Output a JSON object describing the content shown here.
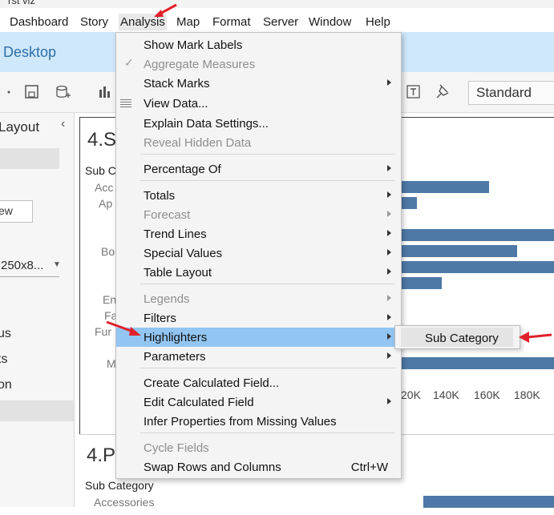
{
  "window": {
    "title_fragment": "rst viz"
  },
  "menubar": {
    "items": [
      "Dashboard",
      "Story",
      "Analysis",
      "Map",
      "Format",
      "Server",
      "Window",
      "Help"
    ]
  },
  "app_band": {
    "title": "Desktop"
  },
  "toolbar": {
    "mark_type": "Standard"
  },
  "left_pane": {
    "header": "Layout",
    "button": "ew",
    "size_value": "250x8...",
    "items": [
      "us",
      "ts",
      "on"
    ]
  },
  "view1": {
    "title": "4.S",
    "sub_header": "Sub C",
    "row_labels": [
      "Acc",
      "Ap",
      "Bo",
      "En",
      "Fa",
      "Fur",
      "M"
    ],
    "bars": [
      {
        "start": 0,
        "end": 0.574
      },
      {
        "start": 0,
        "end": 0.105
      },
      {
        "start": 0,
        "end": 1.0
      },
      {
        "start": 0,
        "end": 0.757
      },
      {
        "start": 0,
        "end": 1.0
      },
      {
        "start": 0,
        "end": 0.266
      },
      {
        "start": 0,
        "end": 1.0
      }
    ],
    "axis_ticks": [
      "20K",
      "140K",
      "160K",
      "180K"
    ]
  },
  "view2": {
    "title": "4.P",
    "sub_header": "Sub Category",
    "first_row": "Accessories"
  },
  "analysis_menu": {
    "items": [
      {
        "label": "Show Mark Labels",
        "disabled": false,
        "submenu": false
      },
      {
        "label": "Aggregate Measures",
        "disabled": true,
        "submenu": false,
        "checked": true
      },
      {
        "label": "Stack Marks",
        "disabled": false,
        "submenu": true
      },
      {
        "label": "View Data...",
        "disabled": false,
        "submenu": false
      },
      {
        "label": "Explain Data Settings...",
        "disabled": false,
        "submenu": false
      },
      {
        "label": "Reveal Hidden Data",
        "disabled": true,
        "submenu": false
      },
      {
        "label": "Percentage Of",
        "disabled": false,
        "submenu": true
      },
      {
        "label": "Totals",
        "disabled": false,
        "submenu": true
      },
      {
        "label": "Forecast",
        "disabled": true,
        "submenu": true
      },
      {
        "label": "Trend Lines",
        "disabled": false,
        "submenu": true
      },
      {
        "label": "Special Values",
        "disabled": false,
        "submenu": true
      },
      {
        "label": "Table Layout",
        "disabled": false,
        "submenu": true
      },
      {
        "label": "Legends",
        "disabled": true,
        "submenu": true
      },
      {
        "label": "Filters",
        "disabled": false,
        "submenu": true
      },
      {
        "label": "Highlighters",
        "disabled": false,
        "submenu": true,
        "highlighted": true
      },
      {
        "label": "Parameters",
        "disabled": false,
        "submenu": true
      },
      {
        "label": "Create Calculated Field...",
        "disabled": false,
        "submenu": false
      },
      {
        "label": "Edit Calculated Field",
        "disabled": false,
        "submenu": true
      },
      {
        "label": "Infer Properties from Missing Values",
        "disabled": false,
        "submenu": false
      },
      {
        "label": "Cycle Fields",
        "disabled": true,
        "submenu": false
      },
      {
        "label": "Swap Rows and Columns",
        "disabled": false,
        "submenu": false,
        "shortcut": "Ctrl+W"
      }
    ]
  },
  "highlighters_submenu": {
    "items": [
      "Sub Category"
    ]
  },
  "colors": {
    "accent_band": "#cfe8fb",
    "highlight": "#92c5f2",
    "bar": "#4e79a7",
    "annotation_arrow": "#e0202a"
  }
}
